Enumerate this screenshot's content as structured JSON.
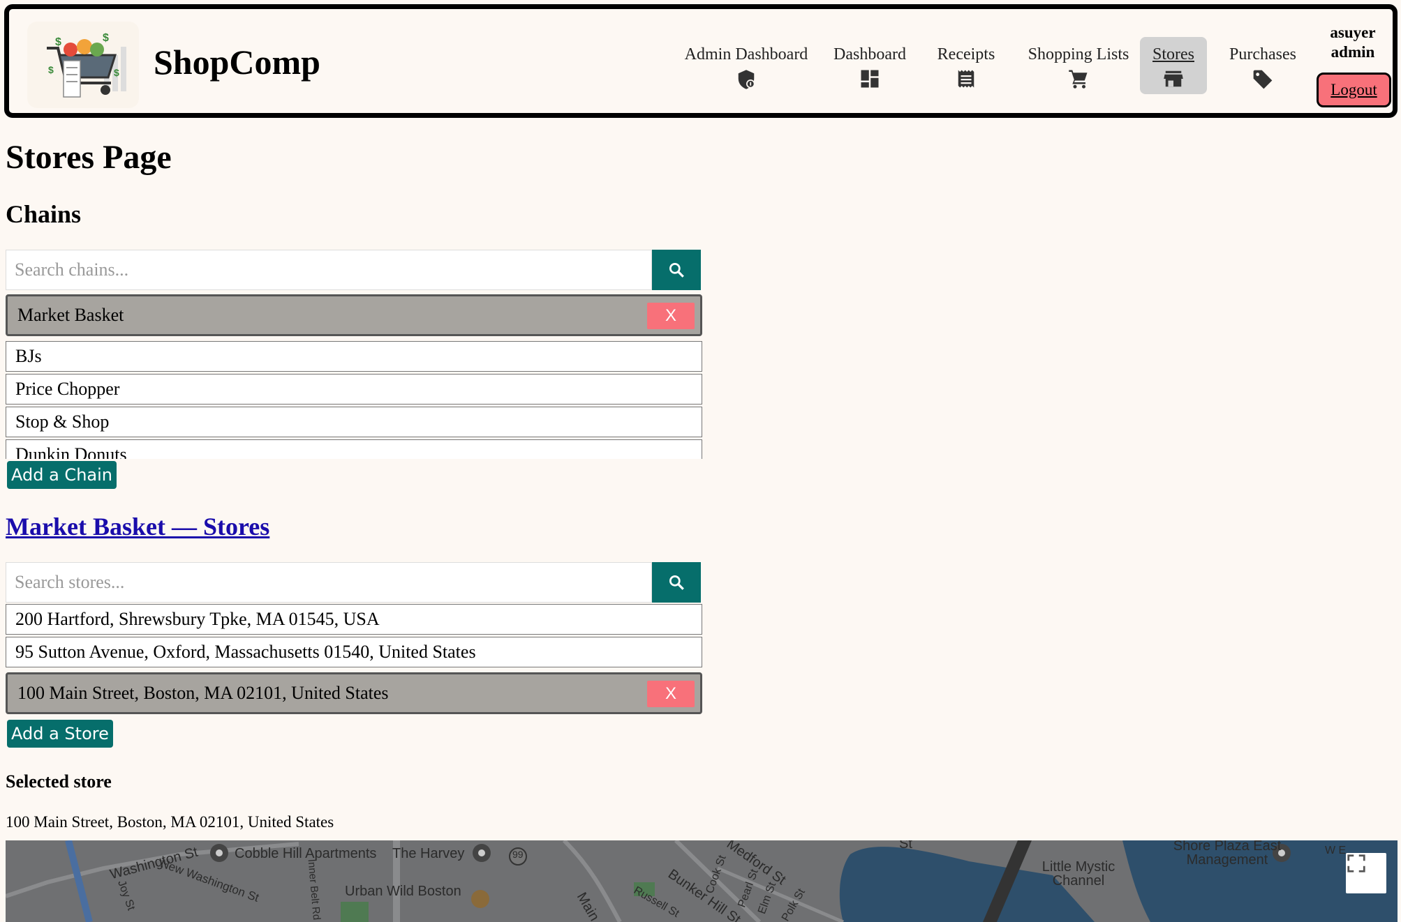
{
  "header": {
    "brand": "ShopComp",
    "nav": [
      {
        "label": "Admin Dashboard",
        "icon": "shield-icon"
      },
      {
        "label": "Dashboard",
        "icon": "dashboard-icon"
      },
      {
        "label": "Receipts",
        "icon": "receipt-icon"
      },
      {
        "label": "Shopping Lists",
        "icon": "cart-icon"
      },
      {
        "label": "Stores",
        "icon": "store-icon",
        "active": true
      },
      {
        "label": "Purchases",
        "icon": "tag-icon"
      }
    ],
    "user": {
      "username": "asuyer",
      "role": "admin"
    },
    "logout_label": "Logout"
  },
  "page_title": "Stores Page",
  "chains": {
    "heading": "Chains",
    "search_placeholder": "Search chains...",
    "selected": "Market Basket",
    "items": [
      "BJs",
      "Price Chopper",
      "Stop & Shop",
      "Dunkin Donuts"
    ],
    "remove_label": "X",
    "add_label": "Add a Chain"
  },
  "stores": {
    "heading": "Market Basket — Stores",
    "search_placeholder": "Search stores...",
    "items": [
      "200 Hartford, Shrewsbury Tpke, MA 01545, USA",
      "95 Sutton Avenue, Oxford, Massachusetts 01540, United States"
    ],
    "selected": "100 Main Street, Boston, MA 02101, United States",
    "remove_label": "X",
    "add_label": "Add a Store"
  },
  "selected_store": {
    "label": "Selected store",
    "address": "100 Main Street, Boston, MA 02101, United States"
  },
  "map": {
    "labels": [
      "Washington St",
      "Cobble Hill Apartments",
      "The Harvey",
      "99",
      "Medford St",
      "Little Mystic Channel",
      "Shore Plaza East Management",
      "W E",
      "St",
      "New Washington St",
      "Inner Belt Rd",
      "Joy St",
      "Cook St",
      "Pearl St",
      "Elm St",
      "Bunker Hill St",
      "Russell St",
      "Urban Wild Boston",
      "Main",
      "Polk St"
    ],
    "colors": {
      "land": "#6f7072",
      "water": "#2e4f6b",
      "park": "#4f7a52",
      "road": "#8a8b8d"
    }
  }
}
